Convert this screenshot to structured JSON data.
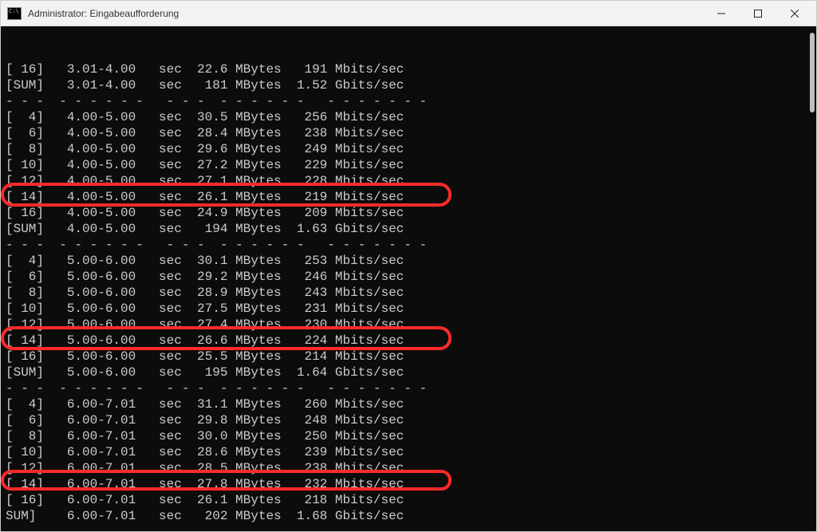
{
  "window": {
    "title": "Administrator: Eingabeaufforderung"
  },
  "separator": "- - -  - - - - - -   - - -  - - - - - -   - - - - - - -",
  "lines": [
    {
      "type": "row",
      "id": "16",
      "interval": "3.01-4.00",
      "transfer": "22.6 MBytes",
      "bitrate": " 191 Mbits/sec"
    },
    {
      "type": "sum",
      "interval": "3.01-4.00",
      "transfer": " 181 MBytes",
      "bitrate": "1.52 Gbits/sec",
      "highlight": false,
      "cut": false
    },
    {
      "type": "sep"
    },
    {
      "type": "row",
      "id": "4",
      "interval": "4.00-5.00",
      "transfer": "30.5 MBytes",
      "bitrate": " 256 Mbits/sec"
    },
    {
      "type": "row",
      "id": "6",
      "interval": "4.00-5.00",
      "transfer": "28.4 MBytes",
      "bitrate": " 238 Mbits/sec"
    },
    {
      "type": "row",
      "id": "8",
      "interval": "4.00-5.00",
      "transfer": "29.6 MBytes",
      "bitrate": " 249 Mbits/sec"
    },
    {
      "type": "row",
      "id": "10",
      "interval": "4.00-5.00",
      "transfer": "27.2 MBytes",
      "bitrate": " 229 Mbits/sec"
    },
    {
      "type": "row",
      "id": "12",
      "interval": "4.00-5.00",
      "transfer": "27.1 MBytes",
      "bitrate": " 228 Mbits/sec"
    },
    {
      "type": "row",
      "id": "14",
      "interval": "4.00-5.00",
      "transfer": "26.1 MBytes",
      "bitrate": " 219 Mbits/sec"
    },
    {
      "type": "row",
      "id": "16",
      "interval": "4.00-5.00",
      "transfer": "24.9 MBytes",
      "bitrate": " 209 Mbits/sec",
      "cut": true
    },
    {
      "type": "sum",
      "interval": "4.00-5.00",
      "transfer": " 194 MBytes",
      "bitrate": "1.63 Gbits/sec",
      "highlight": true,
      "cut": false
    },
    {
      "type": "sep"
    },
    {
      "type": "row",
      "id": "4",
      "interval": "5.00-6.00",
      "transfer": "30.1 MBytes",
      "bitrate": " 253 Mbits/sec"
    },
    {
      "type": "row",
      "id": "6",
      "interval": "5.00-6.00",
      "transfer": "29.2 MBytes",
      "bitrate": " 246 Mbits/sec"
    },
    {
      "type": "row",
      "id": "8",
      "interval": "5.00-6.00",
      "transfer": "28.9 MBytes",
      "bitrate": " 243 Mbits/sec"
    },
    {
      "type": "row",
      "id": "10",
      "interval": "5.00-6.00",
      "transfer": "27.5 MBytes",
      "bitrate": " 231 Mbits/sec"
    },
    {
      "type": "row",
      "id": "12",
      "interval": "5.00-6.00",
      "transfer": "27.4 MBytes",
      "bitrate": " 230 Mbits/sec"
    },
    {
      "type": "row",
      "id": "14",
      "interval": "5.00-6.00",
      "transfer": "26.6 MBytes",
      "bitrate": " 224 Mbits/sec"
    },
    {
      "type": "row",
      "id": "16",
      "interval": "5.00-6.00",
      "transfer": "25.5 MBytes",
      "bitrate": " 214 Mbits/sec",
      "cut": true
    },
    {
      "type": "sum",
      "interval": "5.00-6.00",
      "transfer": " 195 MBytes",
      "bitrate": "1.64 Gbits/sec",
      "highlight": true,
      "cut": false
    },
    {
      "type": "sep"
    },
    {
      "type": "row",
      "id": "4",
      "interval": "6.00-7.01",
      "transfer": "31.1 MBytes",
      "bitrate": " 260 Mbits/sec"
    },
    {
      "type": "row",
      "id": "6",
      "interval": "6.00-7.01",
      "transfer": "29.8 MBytes",
      "bitrate": " 248 Mbits/sec"
    },
    {
      "type": "row",
      "id": "8",
      "interval": "6.00-7.01",
      "transfer": "30.0 MBytes",
      "bitrate": " 250 Mbits/sec"
    },
    {
      "type": "row",
      "id": "10",
      "interval": "6.00-7.01",
      "transfer": "28.6 MBytes",
      "bitrate": " 239 Mbits/sec"
    },
    {
      "type": "row",
      "id": "12",
      "interval": "6.00-7.01",
      "transfer": "28.5 MBytes",
      "bitrate": " 238 Mbits/sec"
    },
    {
      "type": "row",
      "id": "14",
      "interval": "6.00-7.01",
      "transfer": "27.8 MBytes",
      "bitrate": " 232 Mbits/sec"
    },
    {
      "type": "row",
      "id": "16",
      "interval": "6.00-7.01",
      "transfer": "26.1 MBytes",
      "bitrate": " 218 Mbits/sec",
      "cut": true
    },
    {
      "type": "sum",
      "interval": "6.00-7.01",
      "transfer": " 202 MBytes",
      "bitrate": "1.68 Gbits/sec",
      "highlight": true,
      "cut": true
    }
  ]
}
